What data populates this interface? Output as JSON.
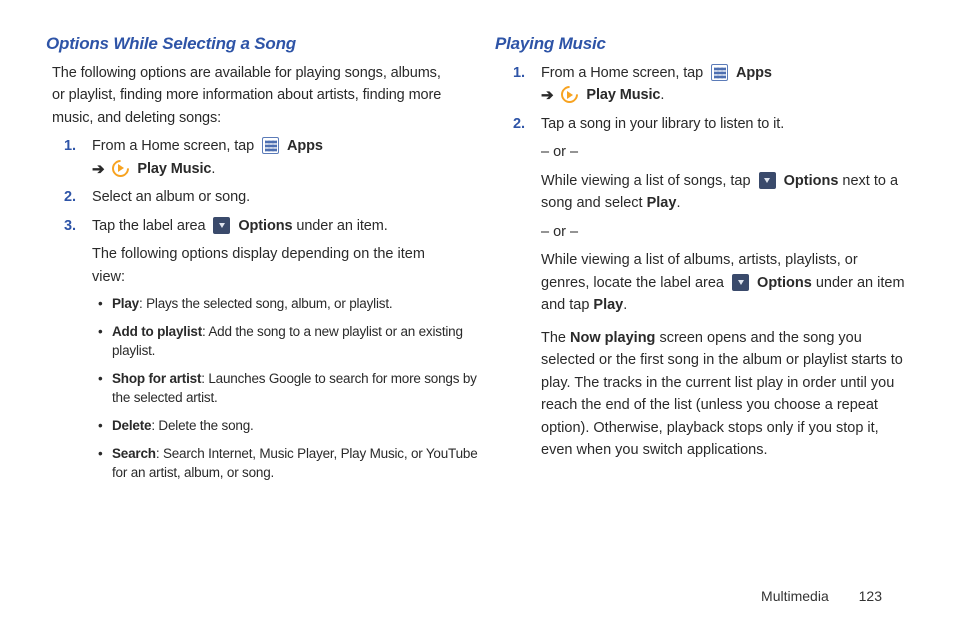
{
  "left": {
    "heading": "Options While Selecting a Song",
    "intro": "The following options are available for playing songs, albums, or playlist, finding more information about artists, finding more music, and deleting songs:",
    "steps": {
      "s1_a": "From a Home screen, tap ",
      "s1_apps": "Apps",
      "s1_arrow": "➔",
      "s1_pm": "Play Music",
      "s1_b": ".",
      "s2": "Select an album or song.",
      "s3_a": "Tap the label area ",
      "s3_opt": "Options",
      "s3_b": " under an item.",
      "s3_c": "The following options display depending on the item view:",
      "num1": "1.",
      "num2": "2.",
      "num3": "3."
    },
    "bullets": {
      "b1_t": "Play",
      "b1_d": ": Plays the selected song, album, or playlist.",
      "b2_t": "Add to playlist",
      "b2_d": ": Add the song to a new playlist or an existing playlist.",
      "b3_t": "Shop for artist",
      "b3_d": ": Launches Google to search for more songs by the selected artist.",
      "b4_t": "Delete",
      "b4_d": ": Delete the song.",
      "b5_t": "Search",
      "b5_d": ": Search Internet, Music Player, Play Music, or YouTube for an artist, album, or song."
    }
  },
  "right": {
    "heading": "Playing Music",
    "steps": {
      "num1": "1.",
      "num2": "2.",
      "s1_a": "From a Home screen, tap ",
      "s1_apps": "Apps",
      "s1_arrow": "➔",
      "s1_pm": "Play Music",
      "s1_b": ".",
      "s2_a": "Tap a song in your library to listen to it.",
      "or": "– or –",
      "s2_b1": "While viewing a list of songs, tap ",
      "s2_opt": "Options",
      "s2_b2": " next to a song and select ",
      "s2_play": "Play",
      "s2_b3": ".",
      "s2_c1": "While viewing a list of albums, artists, playlists, or genres, locate the label area ",
      "s2_c2": " under an item and tap ",
      "s2_c_opt": "Options",
      "s2_c_play": "Play",
      "s2_c3": ".",
      "s2_d1": "The ",
      "s2_d_np": "Now playing",
      "s2_d2": " screen opens and the song you selected or the first song in the album or playlist starts to play. The tracks in the current list play in order until you reach the end of the list (unless you choose a repeat option). Otherwise, playback stops only if you stop it, even when you switch applications."
    }
  },
  "footer": {
    "section": "Multimedia",
    "page": "123"
  }
}
